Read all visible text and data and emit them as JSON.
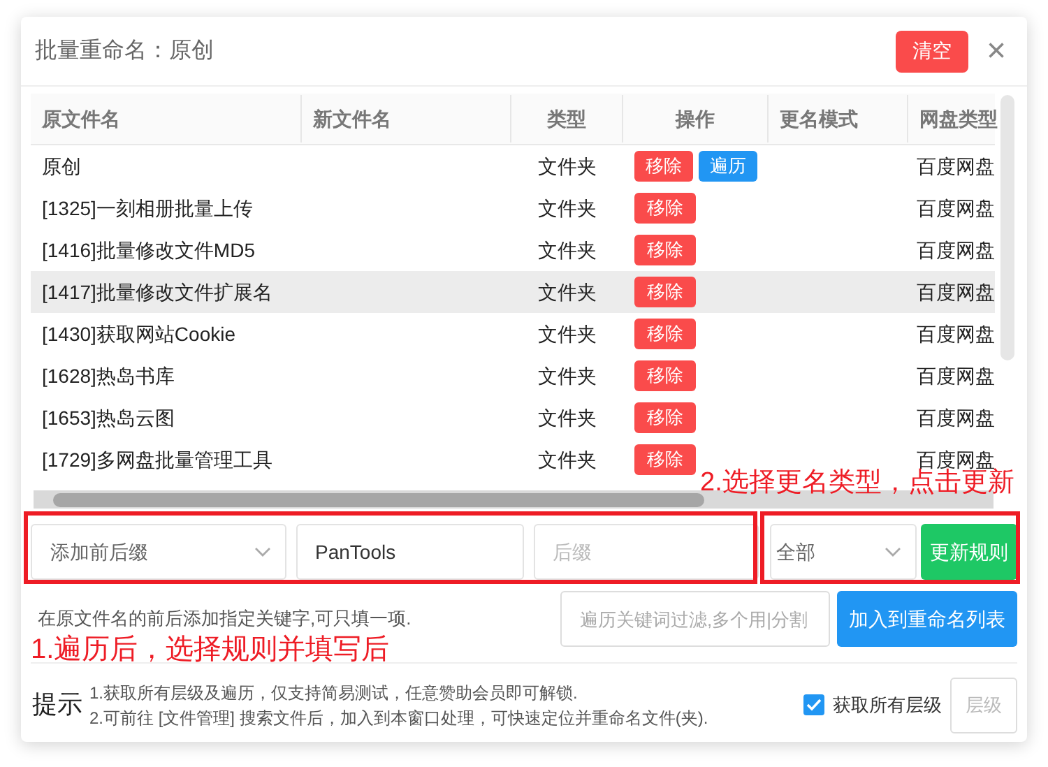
{
  "dialog": {
    "title": "批量重命名：原创",
    "clear_button": "清空",
    "close_icon": "×"
  },
  "table": {
    "columns": [
      "原文件名",
      "新文件名",
      "类型",
      "操作",
      "更名模式",
      "网盘类型"
    ],
    "rows": [
      {
        "name": "原创",
        "new_name": "",
        "type": "文件夹",
        "actions": [
          {
            "kind": "remove",
            "label": "移除"
          },
          {
            "kind": "traverse",
            "label": "遍历"
          }
        ],
        "mode": "",
        "disk": "百度网盘",
        "highlighted": false
      },
      {
        "name": "[1325]一刻相册批量上传",
        "new_name": "",
        "type": "文件夹",
        "actions": [
          {
            "kind": "remove",
            "label": "移除"
          }
        ],
        "mode": "",
        "disk": "百度网盘",
        "highlighted": false
      },
      {
        "name": "[1416]批量修改文件MD5",
        "new_name": "",
        "type": "文件夹",
        "actions": [
          {
            "kind": "remove",
            "label": "移除"
          }
        ],
        "mode": "",
        "disk": "百度网盘",
        "highlighted": false
      },
      {
        "name": "[1417]批量修改文件扩展名",
        "new_name": "",
        "type": "文件夹",
        "actions": [
          {
            "kind": "remove",
            "label": "移除"
          }
        ],
        "mode": "",
        "disk": "百度网盘",
        "highlighted": true
      },
      {
        "name": "[1430]获取网站Cookie",
        "new_name": "",
        "type": "文件夹",
        "actions": [
          {
            "kind": "remove",
            "label": "移除"
          }
        ],
        "mode": "",
        "disk": "百度网盘",
        "highlighted": false
      },
      {
        "name": "[1628]热岛书库",
        "new_name": "",
        "type": "文件夹",
        "actions": [
          {
            "kind": "remove",
            "label": "移除"
          }
        ],
        "mode": "",
        "disk": "百度网盘",
        "highlighted": false
      },
      {
        "name": "[1653]热岛云图",
        "new_name": "",
        "type": "文件夹",
        "actions": [
          {
            "kind": "remove",
            "label": "移除"
          }
        ],
        "mode": "",
        "disk": "百度网盘",
        "highlighted": false
      },
      {
        "name": "[1729]多网盘批量管理工具",
        "new_name": "",
        "type": "文件夹",
        "actions": [
          {
            "kind": "remove",
            "label": "移除"
          }
        ],
        "mode": "",
        "disk": "百度网盘",
        "highlighted": false
      }
    ]
  },
  "rule": {
    "rule_select": "添加前后缀",
    "prefix": {
      "value": "PanTools"
    },
    "suffix": {
      "placeholder": "后缀"
    },
    "scope_select": "全部",
    "update_button": "更新规则"
  },
  "hint": "在原文件名的前后添加指定关键字,可只填一项.",
  "filter": {
    "placeholder": "遍历关键词过滤,多个用|分割"
  },
  "add_button": "加入到重命名列表",
  "tips": {
    "label": "提示",
    "lines": [
      "1.获取所有层级及遍历，仅支持简易测试，任意赞助会员即可解锁.",
      "2.可前往 [文件管理] 搜索文件后，加入到本窗口处理，可快速定位并重命名文件(夹)."
    ]
  },
  "all_levels": {
    "label": "获取所有层级",
    "checked": true
  },
  "level_button": "层级",
  "annotations": [
    {
      "text": "2.选择更名类型，点击更新"
    },
    {
      "text": "1.遍历后，选择规则并填写后"
    }
  ]
}
